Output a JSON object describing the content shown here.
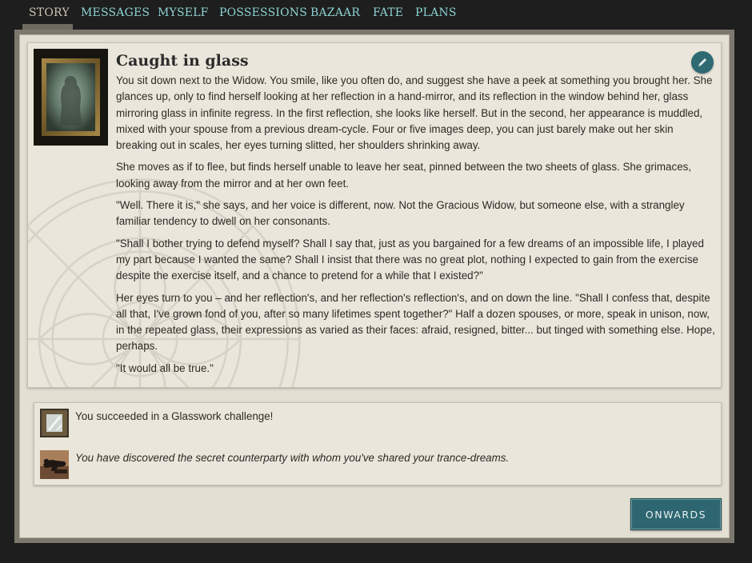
{
  "nav": {
    "tabs": [
      {
        "label": "STORY",
        "active": true
      },
      {
        "label": "MESSAGES"
      },
      {
        "label": "MYSELF"
      },
      {
        "label": "POSSESSIONS"
      },
      {
        "label": "BAZAAR"
      },
      {
        "label": "FATE"
      },
      {
        "label": "PLANS"
      }
    ]
  },
  "story": {
    "title": "Caught in glass",
    "image_icon": "framed-mirror-portrait-icon",
    "edit_icon": "pencil-icon",
    "paragraphs": [
      "You sit down next to the Widow. You smile, like you often do, and suggest she have a peek at something you brought her. She glances up, only to find herself looking at her reflection in a hand-mirror, and its reflection in the window behind her, glass mirroring glass in infinite regress. In the first reflection, she looks like herself. But in the second, her appearance is muddled, mixed with your spouse from a previous dream-cycle. Four or five images deep, you can just barely make out her skin breaking out in scales, her eyes turning slitted, her shoulders shrinking away.",
      "She moves as if to flee, but finds herself unable to leave her seat, pinned between the two sheets of glass. She grimaces, looking away from the mirror and at her own feet.",
      "\"Well. There it is,\" she says, and her voice is different, now. Not the Gracious Widow, but someone else, with a strangley familiar tendency to dwell on her consonants.",
      "\"Shall I bother trying to defend myself? Shall I say that, just as you bargained for a few dreams of an impossible life, I played my part because I wanted the same? Shall I insist that there was no great plot, nothing I expected to gain from the exercise despite the exercise itself, and a chance to pretend for a while that I existed?\"",
      "Her eyes turn to you – and her reflection's, and her reflection's reflection's, and on down the line. \"Shall I confess that, despite all that, I've grown fond of you, after so many lifetimes spent together?\" Half a dozen spouses, or more, speak in unison, now, in the repeated glass, their expressions as varied as their faces: afraid, resigned, bitter... but tinged with something else. Hope, perhaps.",
      "\"It would all be true.\""
    ]
  },
  "results": [
    {
      "icon": "glass-pane-icon",
      "text": "You succeeded in a Glasswork challenge!",
      "italic": false
    },
    {
      "icon": "reclining-figure-icon",
      "text": "You have discovered the secret counterparty with whom you've shared your trance-dreams.",
      "italic": true
    }
  ],
  "onwards": {
    "label": "ONWARDS"
  },
  "colors": {
    "nav_link": "#8dd1d2",
    "nav_active": "#c9c2b0",
    "accent_button": "#2d6670",
    "panel_bg": "#ebe6db",
    "page_bg": "#1e1e1e"
  }
}
